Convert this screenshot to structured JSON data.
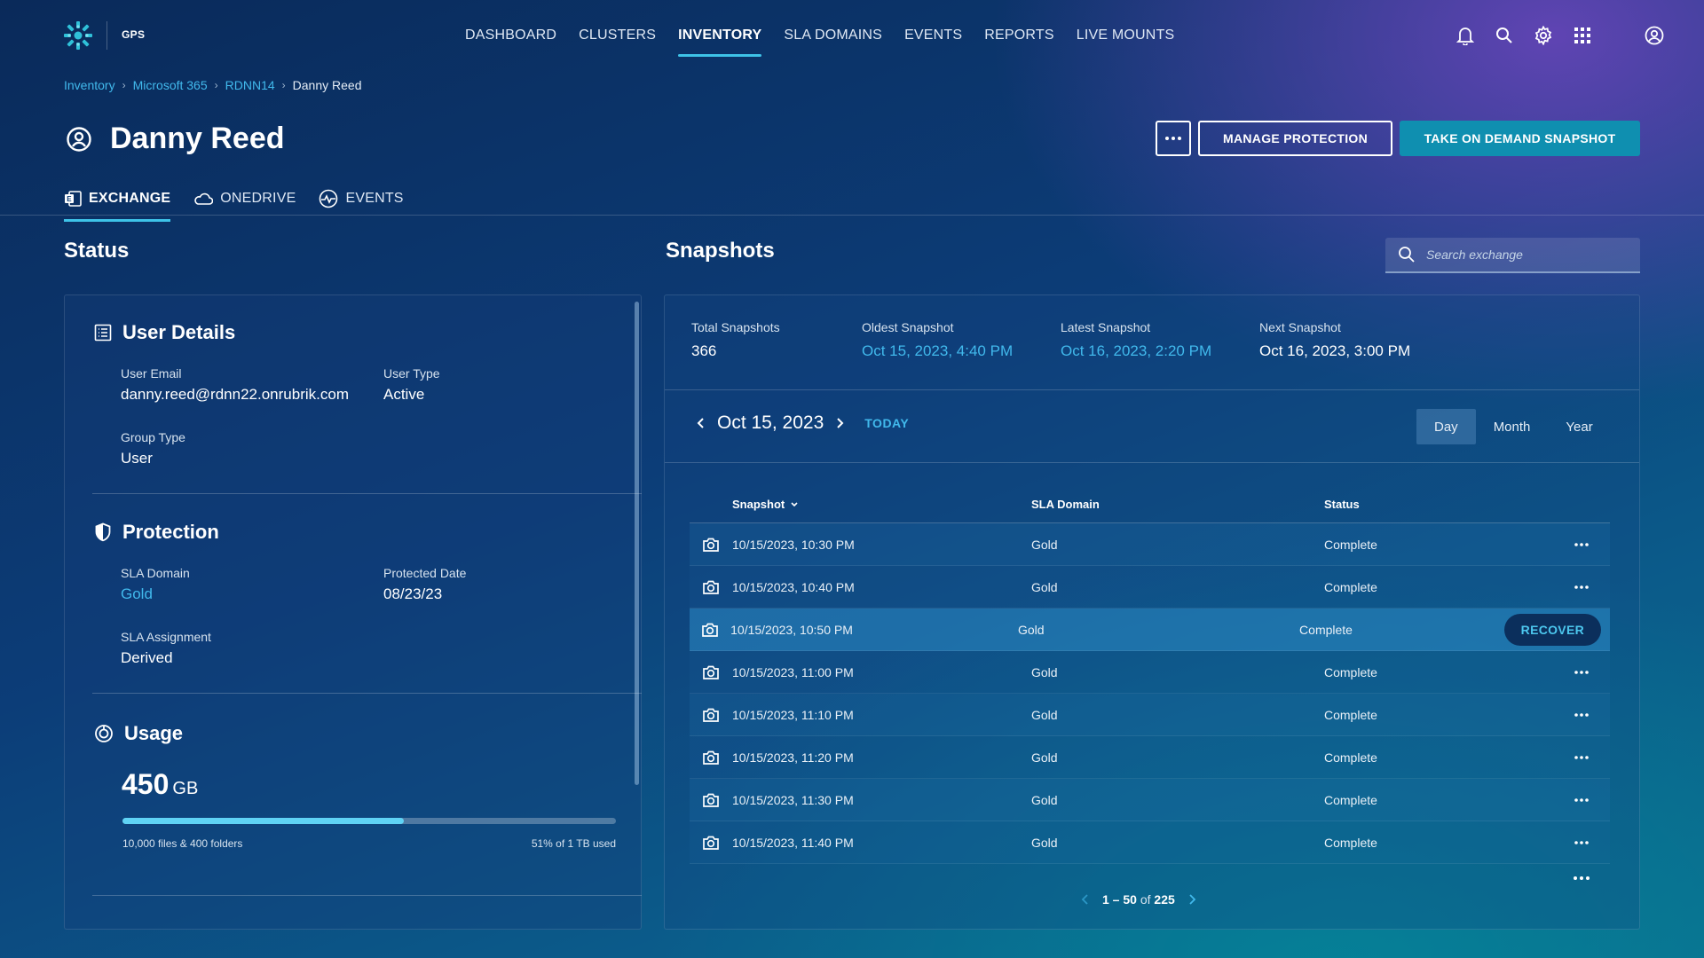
{
  "app": {
    "name": "GPS"
  },
  "nav": {
    "items": [
      {
        "label": "DASHBOARD",
        "active": false
      },
      {
        "label": "CLUSTERS",
        "active": false
      },
      {
        "label": "INVENTORY",
        "active": true
      },
      {
        "label": "SLA DOMAINS",
        "active": false
      },
      {
        "label": "EVENTS",
        "active": false
      },
      {
        "label": "REPORTS",
        "active": false
      },
      {
        "label": "LIVE MOUNTS",
        "active": false
      }
    ],
    "icons": [
      "bell-icon",
      "search-icon",
      "gear-icon",
      "apps-grid-icon",
      "user-account-icon"
    ]
  },
  "breadcrumb": {
    "items": [
      "Inventory",
      "Microsoft 365",
      "RDNN14"
    ],
    "current": "Danny Reed"
  },
  "page": {
    "title": "Danny Reed"
  },
  "actions": {
    "more": "more-options-icon",
    "manage": "MANAGE PROTECTION",
    "snapshot": "TAKE ON DEMAND SNAPSHOT"
  },
  "tabs": [
    {
      "label": "EXCHANGE",
      "active": true,
      "icon": "exchange-icon"
    },
    {
      "label": "ONEDRIVE",
      "active": false,
      "icon": "onedrive-cloud-icon"
    },
    {
      "label": "EVENTS",
      "active": false,
      "icon": "events-pulse-icon"
    }
  ],
  "status": {
    "heading": "Status",
    "user_details": {
      "title": "User Details",
      "email_label": "User Email",
      "email": "danny.reed@rdnn22.onrubrik.com",
      "type_label": "User Type",
      "type": "Active",
      "group_label": "Group Type",
      "group": "User"
    },
    "protection": {
      "title": "Protection",
      "sla_label": "SLA Domain",
      "sla": "Gold",
      "date_label": "Protected Date",
      "date": "08/23/23",
      "assign_label": "SLA Assignment",
      "assign": "Derived"
    },
    "usage": {
      "title": "Usage",
      "amount": "450",
      "unit": "GB",
      "files": "10,000 files & 400 folders",
      "used": "51% of 1 TB used",
      "fraction": 0.57
    }
  },
  "snapshots": {
    "heading": "Snapshots",
    "search_placeholder": "Search exchange",
    "stats": {
      "total_label": "Total Snapshots",
      "total": "366",
      "oldest_label": "Oldest Snapshot",
      "oldest": "Oct 15, 2023, 4:40 PM",
      "latest_label": "Latest Snapshot",
      "latest": "Oct 16, 2023, 2:20 PM",
      "next_label": "Next Snapshot",
      "next": "Oct 16, 2023, 3:00 PM"
    },
    "date": "Oct 15, 2023",
    "today": "TODAY",
    "views": [
      "Day",
      "Month",
      "Year"
    ],
    "active_view": "Day",
    "columns": {
      "snapshot": "Snapshot",
      "sla": "SLA Domain",
      "status": "Status"
    },
    "rows": [
      {
        "time": "10/15/2023, 10:30 PM",
        "sla": "Gold",
        "status": "Complete"
      },
      {
        "time": "10/15/2023, 10:40 PM",
        "sla": "Gold",
        "status": "Complete"
      },
      {
        "time": "10/15/2023, 10:50 PM",
        "sla": "Gold",
        "status": "Complete",
        "hover": true
      },
      {
        "time": "10/15/2023, 11:00 PM",
        "sla": "Gold",
        "status": "Complete"
      },
      {
        "time": "10/15/2023, 11:10 PM",
        "sla": "Gold",
        "status": "Complete"
      },
      {
        "time": "10/15/2023, 11:20 PM",
        "sla": "Gold",
        "status": "Complete"
      },
      {
        "time": "10/15/2023, 11:30 PM",
        "sla": "Gold",
        "status": "Complete"
      },
      {
        "time": "10/15/2023, 11:40 PM",
        "sla": "Gold",
        "status": "Complete"
      }
    ],
    "recover_label": "RECOVER",
    "pager": {
      "range": "1 – 50",
      "of": "of",
      "total": "225"
    }
  },
  "colors": {
    "accent": "#41b9ec",
    "primary_button": "#0f8fb0",
    "usage_fill": "#5fd3f5"
  }
}
